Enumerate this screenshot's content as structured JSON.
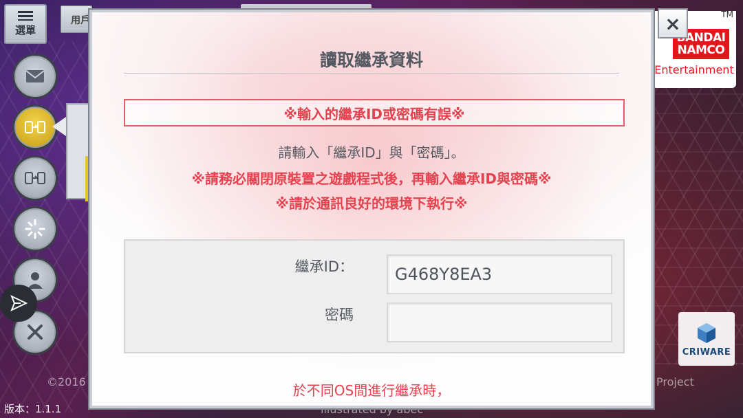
{
  "app": {
    "menu_label": "選單",
    "user_tab_label": "用戶",
    "version_text": "版本：1.1.1",
    "copyright_text": "©2016",
    "illustrated_text": "illustrated by abec",
    "project_text": "Project"
  },
  "sidebar": {
    "items": [
      {
        "icon": "mail-icon"
      },
      {
        "icon": "device-transfer-icon",
        "active": true
      },
      {
        "icon": "device-transfer-icon"
      },
      {
        "icon": "loading-spinner-icon"
      },
      {
        "icon": "person-icon"
      },
      {
        "icon": "tools-icon"
      }
    ],
    "share_icon": "share-icon"
  },
  "logos": {
    "bandai": "BANDAI\nNAMCO",
    "entertainment": "Entertainment",
    "tm": "TM",
    "criware": "CRIWARE"
  },
  "dialog": {
    "title": "讀取繼承資料",
    "error_message": "※輸入的繼承ID或密碼有誤※",
    "instruction": "請輸入「繼承ID」與「密碼」。",
    "warning_1": "※請務必關閉原裝置之遊戲程式後，再輸入繼承ID與密碼※",
    "warning_2": "※請於通訊良好的環境下執行※",
    "id_label": "繼承ID：",
    "id_value": "G468Y8EA3",
    "password_label": "密碼",
    "password_value": "",
    "bottom_note": "於不同OS間進行繼承時，",
    "close_symbol": "×"
  },
  "colors": {
    "error_red": "#e4424f",
    "active_yellow": "#f3d44a",
    "brand_red": "#e3161e"
  }
}
